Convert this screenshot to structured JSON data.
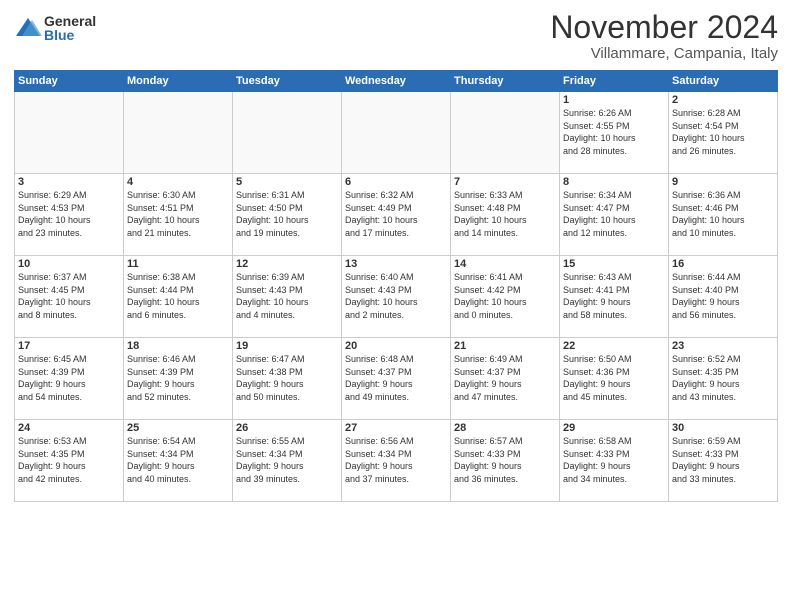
{
  "logo": {
    "general": "General",
    "blue": "Blue"
  },
  "title": "November 2024",
  "location": "Villammare, Campania, Italy",
  "headers": [
    "Sunday",
    "Monday",
    "Tuesday",
    "Wednesday",
    "Thursday",
    "Friday",
    "Saturday"
  ],
  "weeks": [
    [
      {
        "day": "",
        "info": ""
      },
      {
        "day": "",
        "info": ""
      },
      {
        "day": "",
        "info": ""
      },
      {
        "day": "",
        "info": ""
      },
      {
        "day": "",
        "info": ""
      },
      {
        "day": "1",
        "info": "Sunrise: 6:26 AM\nSunset: 4:55 PM\nDaylight: 10 hours\nand 28 minutes."
      },
      {
        "day": "2",
        "info": "Sunrise: 6:28 AM\nSunset: 4:54 PM\nDaylight: 10 hours\nand 26 minutes."
      }
    ],
    [
      {
        "day": "3",
        "info": "Sunrise: 6:29 AM\nSunset: 4:53 PM\nDaylight: 10 hours\nand 23 minutes."
      },
      {
        "day": "4",
        "info": "Sunrise: 6:30 AM\nSunset: 4:51 PM\nDaylight: 10 hours\nand 21 minutes."
      },
      {
        "day": "5",
        "info": "Sunrise: 6:31 AM\nSunset: 4:50 PM\nDaylight: 10 hours\nand 19 minutes."
      },
      {
        "day": "6",
        "info": "Sunrise: 6:32 AM\nSunset: 4:49 PM\nDaylight: 10 hours\nand 17 minutes."
      },
      {
        "day": "7",
        "info": "Sunrise: 6:33 AM\nSunset: 4:48 PM\nDaylight: 10 hours\nand 14 minutes."
      },
      {
        "day": "8",
        "info": "Sunrise: 6:34 AM\nSunset: 4:47 PM\nDaylight: 10 hours\nand 12 minutes."
      },
      {
        "day": "9",
        "info": "Sunrise: 6:36 AM\nSunset: 4:46 PM\nDaylight: 10 hours\nand 10 minutes."
      }
    ],
    [
      {
        "day": "10",
        "info": "Sunrise: 6:37 AM\nSunset: 4:45 PM\nDaylight: 10 hours\nand 8 minutes."
      },
      {
        "day": "11",
        "info": "Sunrise: 6:38 AM\nSunset: 4:44 PM\nDaylight: 10 hours\nand 6 minutes."
      },
      {
        "day": "12",
        "info": "Sunrise: 6:39 AM\nSunset: 4:43 PM\nDaylight: 10 hours\nand 4 minutes."
      },
      {
        "day": "13",
        "info": "Sunrise: 6:40 AM\nSunset: 4:43 PM\nDaylight: 10 hours\nand 2 minutes."
      },
      {
        "day": "14",
        "info": "Sunrise: 6:41 AM\nSunset: 4:42 PM\nDaylight: 10 hours\nand 0 minutes."
      },
      {
        "day": "15",
        "info": "Sunrise: 6:43 AM\nSunset: 4:41 PM\nDaylight: 9 hours\nand 58 minutes."
      },
      {
        "day": "16",
        "info": "Sunrise: 6:44 AM\nSunset: 4:40 PM\nDaylight: 9 hours\nand 56 minutes."
      }
    ],
    [
      {
        "day": "17",
        "info": "Sunrise: 6:45 AM\nSunset: 4:39 PM\nDaylight: 9 hours\nand 54 minutes."
      },
      {
        "day": "18",
        "info": "Sunrise: 6:46 AM\nSunset: 4:39 PM\nDaylight: 9 hours\nand 52 minutes."
      },
      {
        "day": "19",
        "info": "Sunrise: 6:47 AM\nSunset: 4:38 PM\nDaylight: 9 hours\nand 50 minutes."
      },
      {
        "day": "20",
        "info": "Sunrise: 6:48 AM\nSunset: 4:37 PM\nDaylight: 9 hours\nand 49 minutes."
      },
      {
        "day": "21",
        "info": "Sunrise: 6:49 AM\nSunset: 4:37 PM\nDaylight: 9 hours\nand 47 minutes."
      },
      {
        "day": "22",
        "info": "Sunrise: 6:50 AM\nSunset: 4:36 PM\nDaylight: 9 hours\nand 45 minutes."
      },
      {
        "day": "23",
        "info": "Sunrise: 6:52 AM\nSunset: 4:35 PM\nDaylight: 9 hours\nand 43 minutes."
      }
    ],
    [
      {
        "day": "24",
        "info": "Sunrise: 6:53 AM\nSunset: 4:35 PM\nDaylight: 9 hours\nand 42 minutes."
      },
      {
        "day": "25",
        "info": "Sunrise: 6:54 AM\nSunset: 4:34 PM\nDaylight: 9 hours\nand 40 minutes."
      },
      {
        "day": "26",
        "info": "Sunrise: 6:55 AM\nSunset: 4:34 PM\nDaylight: 9 hours\nand 39 minutes."
      },
      {
        "day": "27",
        "info": "Sunrise: 6:56 AM\nSunset: 4:34 PM\nDaylight: 9 hours\nand 37 minutes."
      },
      {
        "day": "28",
        "info": "Sunrise: 6:57 AM\nSunset: 4:33 PM\nDaylight: 9 hours\nand 36 minutes."
      },
      {
        "day": "29",
        "info": "Sunrise: 6:58 AM\nSunset: 4:33 PM\nDaylight: 9 hours\nand 34 minutes."
      },
      {
        "day": "30",
        "info": "Sunrise: 6:59 AM\nSunset: 4:33 PM\nDaylight: 9 hours\nand 33 minutes."
      }
    ]
  ]
}
